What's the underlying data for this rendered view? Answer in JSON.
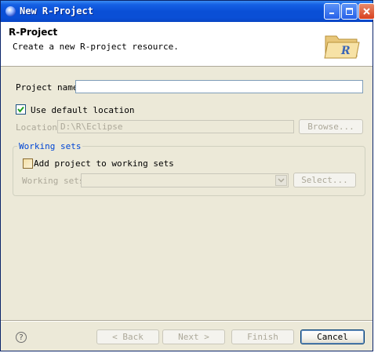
{
  "window": {
    "title": "New R-Project"
  },
  "header": {
    "title": "R-Project",
    "description": "Create a new R-project resource."
  },
  "form": {
    "project_name_label": "Project name:",
    "project_name_value": "",
    "use_default_location_label": "Use default location",
    "use_default_location_checked": true,
    "location_label": "Location:",
    "location_value": "D:\\R\\Eclipse",
    "browse_label": "Browse..."
  },
  "working_sets": {
    "group_label": "Working sets",
    "add_label": "Add project to working sets",
    "add_checked": false,
    "sets_label": "Working sets:",
    "sets_value": "",
    "select_label": "Select..."
  },
  "footer": {
    "back_label": "< Back",
    "next_label": "Next >",
    "finish_label": "Finish",
    "cancel_label": "Cancel"
  },
  "icons": {
    "app": "eclipse-icon",
    "minimize": "minimize-icon",
    "maximize": "maximize-icon",
    "close": "close-icon",
    "wizard": "r-folder-icon",
    "help": "help-icon"
  },
  "colors": {
    "titlebar": "#0a4fd6",
    "dialog": "#ece9d8",
    "group_label": "#0046d5",
    "disabled_text": "#aca899"
  }
}
